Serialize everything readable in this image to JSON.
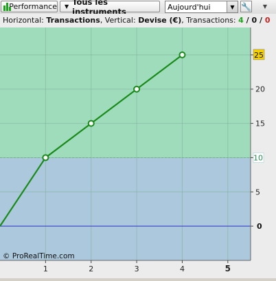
{
  "toolbar": {
    "performance_label": "Performance",
    "instruments_label": "Tous les instruments",
    "period_value": "Aujourd'hui",
    "tool_icon": "wrench-icon",
    "scroll_icon": "triangle-down-icon"
  },
  "header": {
    "h_prefix": "Horizontal: ",
    "h_value": "Transactions",
    "v_prefix": ", Vertical: ",
    "v_value": "Devise (€)",
    "t_prefix": ", Transactions: ",
    "t_won": "4",
    "sep1": " / ",
    "t_neutral": "0",
    "sep2": " / ",
    "t_lost": "0"
  },
  "colors": {
    "gain_zone": "#9fdcbc",
    "loss_zone": "#abc8dc",
    "line": "#1a8a1a",
    "zero_line": "#3333cc",
    "won": "#1aa51a",
    "lost": "#cc2222",
    "last_value_badge": "#f5d000"
  },
  "watermark": "© ProRealTime.com",
  "chart_data": {
    "type": "line",
    "x": [
      0,
      1,
      2,
      3,
      4
    ],
    "y": [
      0,
      10,
      15,
      20,
      25
    ],
    "xlim": [
      0,
      5.5
    ],
    "ylim": [
      -5,
      29
    ],
    "x_ticks": [
      "1",
      "2",
      "3",
      "4",
      "5"
    ],
    "y_ticks": [
      "0",
      "5",
      "10",
      "15",
      "20",
      "25"
    ],
    "reference_level": 10,
    "reference_label": "10",
    "last_value_label": "25",
    "zero_label": "0",
    "grid": true
  }
}
